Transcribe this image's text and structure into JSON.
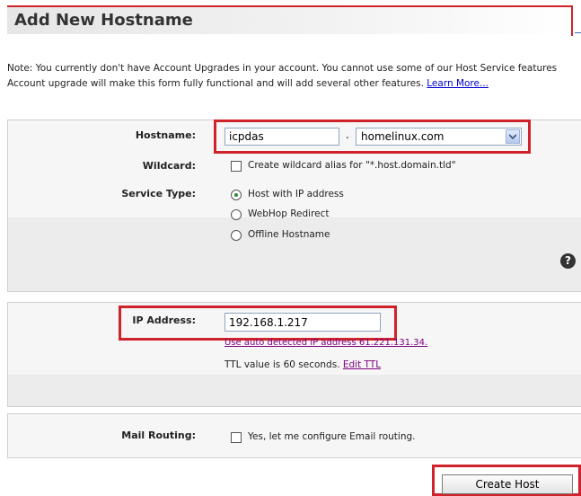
{
  "page": {
    "title": "Add New Hostname"
  },
  "note": {
    "line1": "Note: You currently don't have Account Upgrades in your account. You cannot use some of our Host Service features",
    "line2": "Account upgrade will make this form fully functional and will add several other features.",
    "learn_more": "Learn More..."
  },
  "hostname_section": {
    "hostname_label": "Hostname:",
    "hostname_value": "icpdas",
    "separator": ".",
    "domain_selected": "homelinux.com",
    "wildcard_label": "Wildcard:",
    "wildcard_checkbox_label": "Create wildcard alias for \"*.host.domain.tld\"",
    "service_type_label": "Service Type:",
    "service_options": [
      {
        "label": "Host with IP address",
        "selected": true
      },
      {
        "label": "WebHop Redirect",
        "selected": false
      },
      {
        "label": "Offline Hostname",
        "selected": false
      }
    ],
    "help_icon": "help-icon"
  },
  "ip_section": {
    "ip_label": "IP Address:",
    "ip_value": "192.168.1.217",
    "auto_detect_link": "Use auto detected IP address 61.221.131.34.",
    "ttl_text": "TTL value is 60 seconds.",
    "edit_ttl": "Edit TTL"
  },
  "mail_section": {
    "mail_label": "Mail Routing:",
    "mail_checkbox_label": "Yes, let me configure Email routing."
  },
  "actions": {
    "create_host_label": "Create Host"
  },
  "colors": {
    "highlight_red": "#d0222a",
    "link_blue": "#0000cc",
    "link_visited": "#800080"
  }
}
